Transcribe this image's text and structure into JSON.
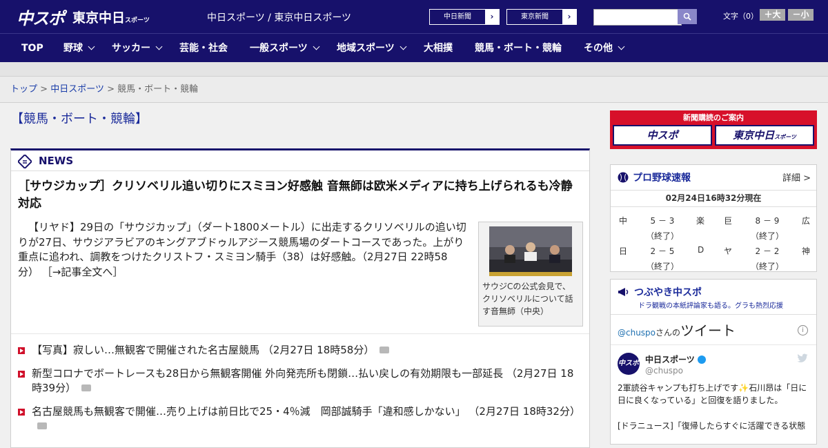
{
  "header": {
    "logo_main": "中スポ",
    "logo_tokyo": "東京中日",
    "logo_tokyo_small": "スポーツ",
    "site_names": "中日スポーツ / 東京中日スポーツ",
    "paper_links": [
      "中日新聞",
      "東京新聞"
    ],
    "search_placeholder": "",
    "font_size_label": "文字（0）",
    "font_bigger": "＋大",
    "font_smaller": "－小"
  },
  "nav": {
    "items": [
      {
        "label": "TOP",
        "dropdown": false
      },
      {
        "label": "野球",
        "dropdown": true
      },
      {
        "label": "サッカー",
        "dropdown": true
      },
      {
        "label": "芸能・社会",
        "dropdown": false
      },
      {
        "label": "一般スポーツ",
        "dropdown": true
      },
      {
        "label": "地域スポーツ",
        "dropdown": true
      },
      {
        "label": "大相撲",
        "dropdown": false
      },
      {
        "label": "競馬・ボート・競輪",
        "dropdown": false
      },
      {
        "label": "その他",
        "dropdown": true
      }
    ]
  },
  "breadcrumb": {
    "items": [
      "トップ",
      "中日スポーツ",
      "競馬・ボート・競輪"
    ],
    "separator": ">"
  },
  "main": {
    "page_title": "【競馬・ボート・競輪】",
    "news_label": "NEWS",
    "headline": "［サウジカップ］クリソベリル追い切りにスミヨン好感触 音無師は欧米メディアに持ち上げられるも冷静対応",
    "lead": "【リヤド】29日の「サウジカップ」（ダート1800メートル）に出走するクリソベリルの追い切りが27日、サウジアラビアのキングアブドゥルアジース競馬場のダートコースであった。上がり重点に追われ、調教をつけたクリストフ・スミヨン騎手（38）は好感触。（2月27日 22時58分）",
    "read_more": "［→記事全文へ］",
    "photo_caption": "サウジCの公式会見で、クリソベリルについて話す音無師（中央）",
    "related": [
      {
        "text": "【写真】寂しい…無観客で開催された名古屋競馬 （2月27日 18時58分）",
        "photo": true
      },
      {
        "text": "新型コロナでボートレースも28日から無観客開催 外向発売所も閉鎖…払い戻しの有効期限も一部延長 （2月27日 18時39分）",
        "photo": true
      },
      {
        "text": "名古屋競馬も無観客で開催…売り上げは前日比で25・4％減　岡部誠騎手「違和感しかない」 （2月27日 18時32分）",
        "photo": true
      }
    ]
  },
  "sidebar": {
    "promo_title": "新聞購読のご案内",
    "promo_buttons": [
      "中スポ",
      "東京中日"
    ],
    "promo_small": "スポーツ",
    "baseball": {
      "title": "プロ野球速報",
      "detail_link": "詳細 >",
      "timestamp": "02月24日16時32分現在",
      "games": [
        {
          "home": "中",
          "score": "5 － 3",
          "away": "楽",
          "status": "（終了）"
        },
        {
          "home": "巨",
          "score": "8 － 9",
          "away": "広",
          "status": "（終了）"
        },
        {
          "home": "日",
          "score": "2 － 5",
          "away": "D",
          "status": "（終了）"
        },
        {
          "home": "ヤ",
          "score": "2 － 2",
          "away": "神",
          "status": "（終了）"
        }
      ]
    },
    "twitter": {
      "title": "つぶやき中スポ",
      "subtitle": "ドラ観戦の本紙評論家も語る。グラも熱烈応援",
      "timeline_user": "@chuspo",
      "timeline_suffix": "さんの",
      "timeline_label": "ツイート",
      "account_name": "中日スポーツ",
      "account_handle": "@chuspo",
      "avatar_text": "中スポ",
      "tweet_text": "2軍読谷キャンプも打ち上げです✨石川昂は「日に日に良くなっている」と回復を語りました。",
      "tweet_text2": "[ドラニュース]「復帰したらすぐに活躍できる状態"
    }
  },
  "colors": {
    "brand_navy": "#17116b",
    "accent_red": "#d7102a",
    "link_blue": "#1a3da8"
  }
}
